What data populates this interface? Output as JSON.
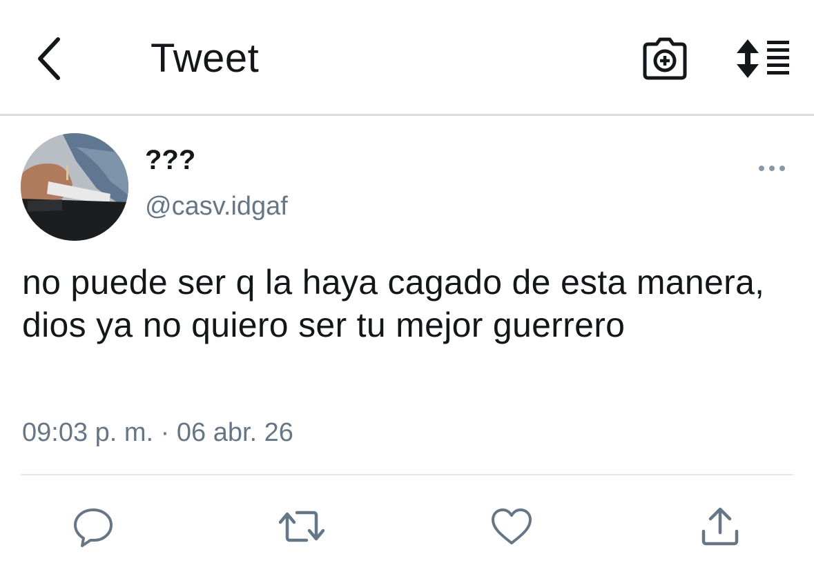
{
  "header": {
    "title": "Tweet",
    "back_icon": "chevron-left-icon",
    "camera_icon": "camera-plus-icon",
    "sort_icon": "sort-list-icon"
  },
  "tweet": {
    "display_name": "???",
    "handle": "@casv.idgaf",
    "text": "no puede ser q la haya cagado de esta manera, dios ya no quiero ser tu mejor guerrero",
    "timestamp": "09:03 p. m. · 06 abr. 26",
    "more_icon": "more-dots-icon"
  },
  "actions": [
    {
      "name": "reply",
      "icon": "reply-icon"
    },
    {
      "name": "retweet",
      "icon": "retweet-icon"
    },
    {
      "name": "like",
      "icon": "heart-icon"
    },
    {
      "name": "share",
      "icon": "share-icon"
    }
  ],
  "colors": {
    "text_primary": "#14171a",
    "text_secondary": "#657786",
    "icon": "#657786",
    "divider": "#e1e8ed"
  }
}
